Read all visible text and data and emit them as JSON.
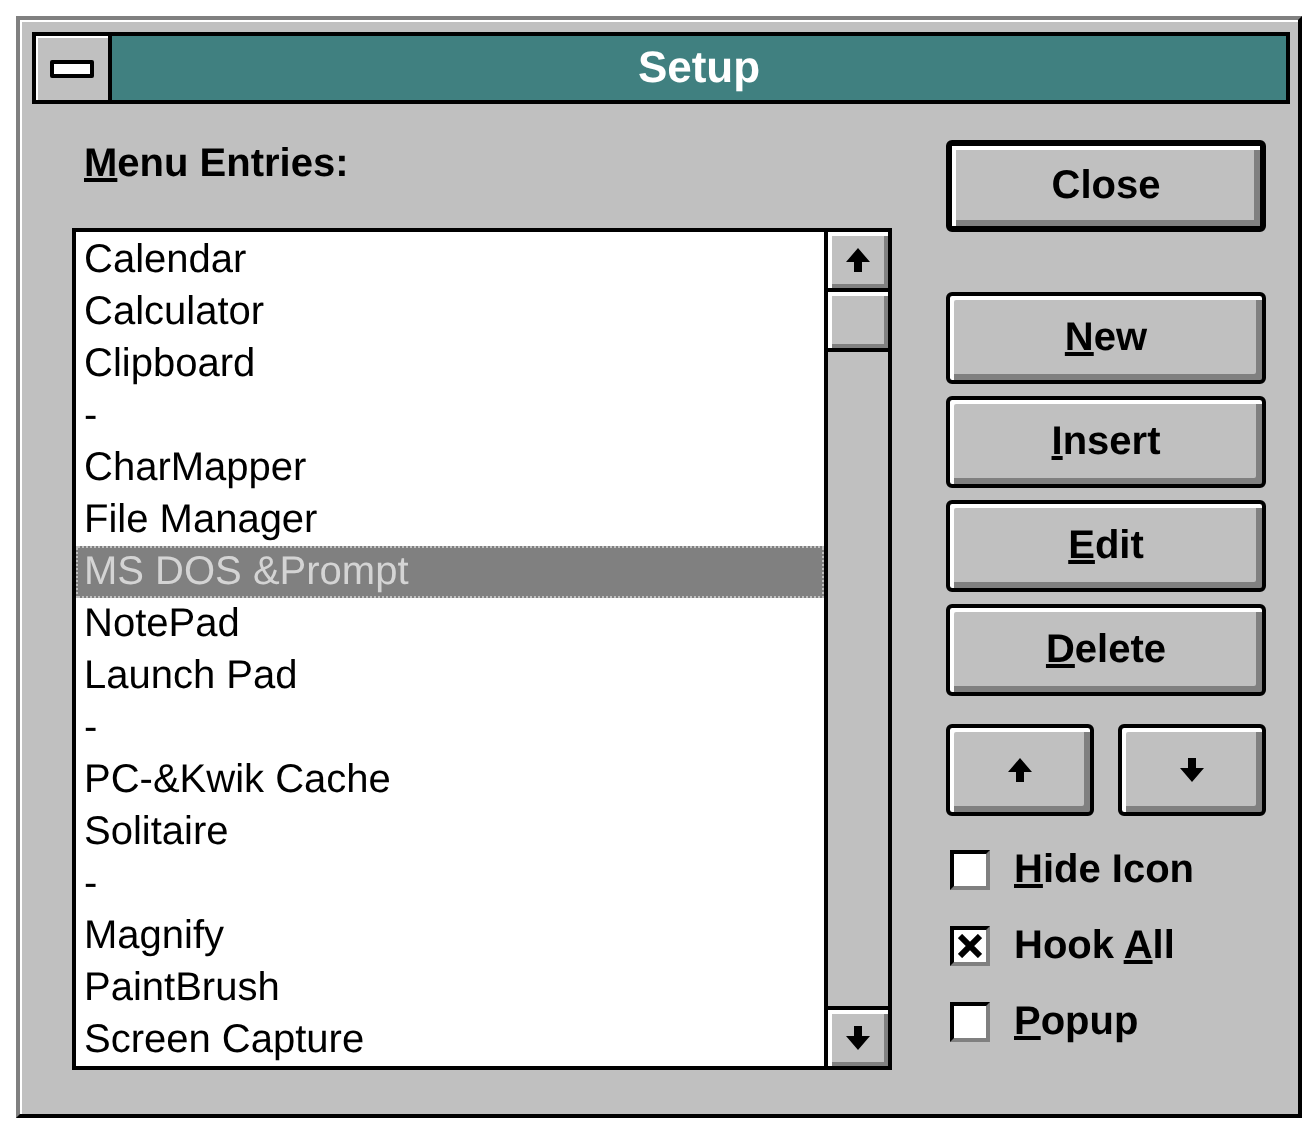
{
  "window": {
    "title": "Setup"
  },
  "menu_entries": {
    "label": {
      "key": "M",
      "post": "enu Entries:"
    },
    "items": [
      {
        "text": "Calendar",
        "selected": false
      },
      {
        "text": "Calculator",
        "selected": false
      },
      {
        "text": "Clipboard",
        "selected": false
      },
      {
        "text": "-",
        "selected": false
      },
      {
        "text": "CharMapper",
        "selected": false
      },
      {
        "text": "File Manager",
        "selected": false
      },
      {
        "text": "MS DOS &Prompt",
        "selected": true
      },
      {
        "text": "NotePad",
        "selected": false
      },
      {
        "text": "Launch Pad",
        "selected": false
      },
      {
        "text": "-",
        "selected": false
      },
      {
        "text": "PC-&Kwik Cache",
        "selected": false
      },
      {
        "text": "Solitaire",
        "selected": false
      },
      {
        "text": "-",
        "selected": false
      },
      {
        "text": "Magnify",
        "selected": false
      },
      {
        "text": "PaintBrush",
        "selected": false
      },
      {
        "text": "Screen Capture",
        "selected": false
      }
    ]
  },
  "close_button": {
    "pre": "Close",
    "default": true
  },
  "buttons": [
    {
      "key": "N",
      "post": "ew"
    },
    {
      "key": "I",
      "post": "nsert"
    },
    {
      "key": "E",
      "post": "dit"
    },
    {
      "key": "D",
      "post": "elete"
    }
  ],
  "move_buttons": [
    {
      "kind": "up"
    },
    {
      "kind": "down"
    }
  ],
  "options": [
    {
      "key": "H",
      "post": "ide Icon",
      "checked": false
    },
    {
      "pre": "Hook ",
      "key": "A",
      "post": "ll",
      "checked": true
    },
    {
      "key": "P",
      "post": "opup",
      "checked": false
    }
  ]
}
